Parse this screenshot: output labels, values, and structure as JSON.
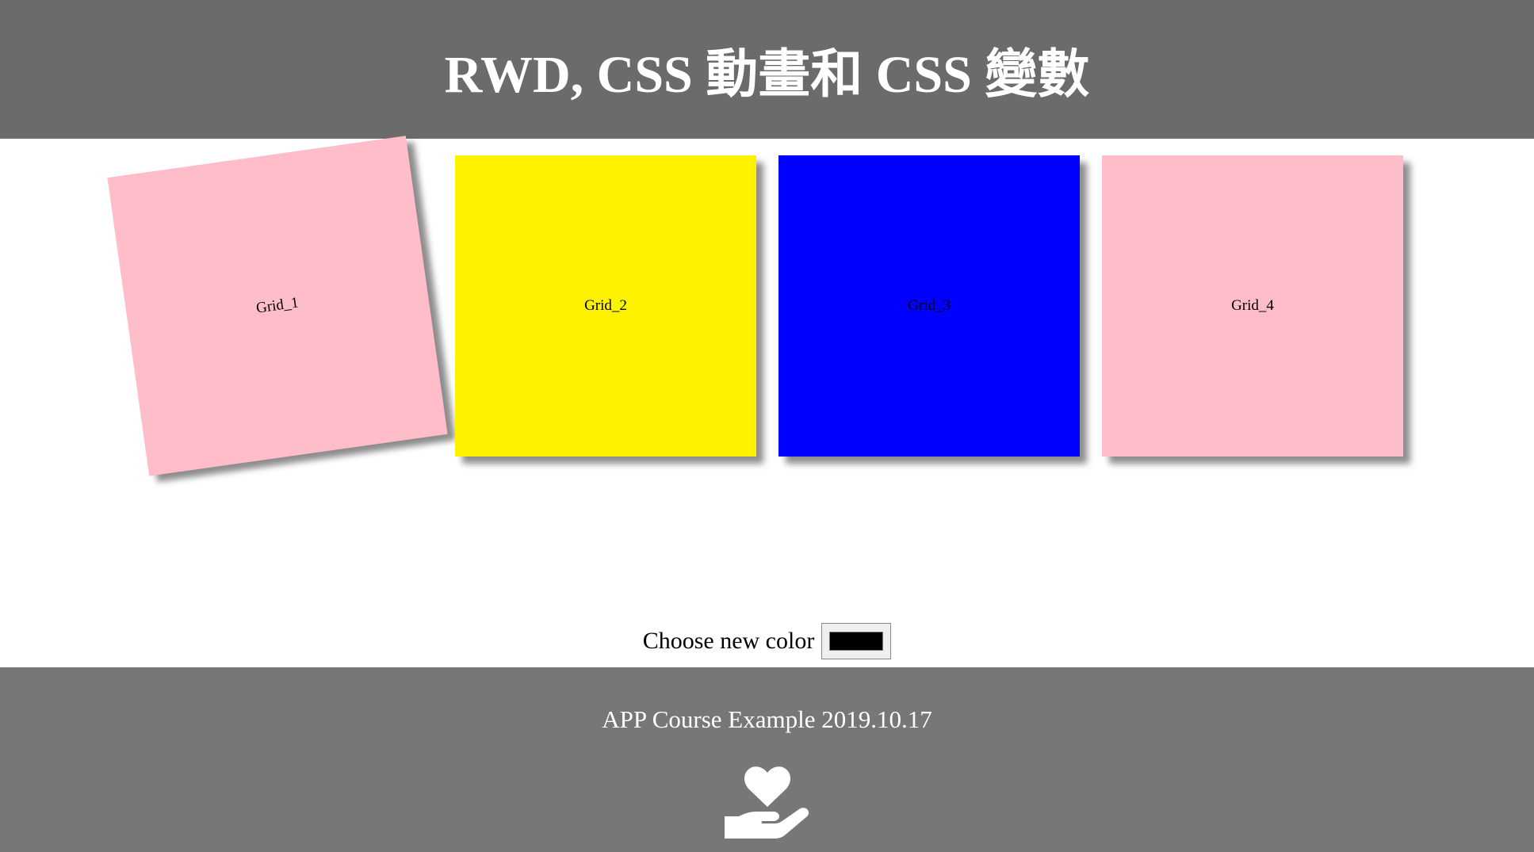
{
  "header": {
    "title": "RWD, CSS 動畫和 CSS 變數"
  },
  "grids": [
    {
      "label": "Grid_1",
      "color": "#ffbcc9"
    },
    {
      "label": "Grid_2",
      "color": "#fff200"
    },
    {
      "label": "Grid_3",
      "color": "#0000ff"
    },
    {
      "label": "Grid_4",
      "color": "#ffbcc9"
    }
  ],
  "color_picker": {
    "label": "Choose new color",
    "value": "#000000"
  },
  "footer": {
    "text": "APP Course Example 2019.10.17",
    "icon": "hand-holding-heart-icon"
  },
  "colors": {
    "header_bg": "#6b6b6b",
    "footer_bg": "#777777"
  }
}
